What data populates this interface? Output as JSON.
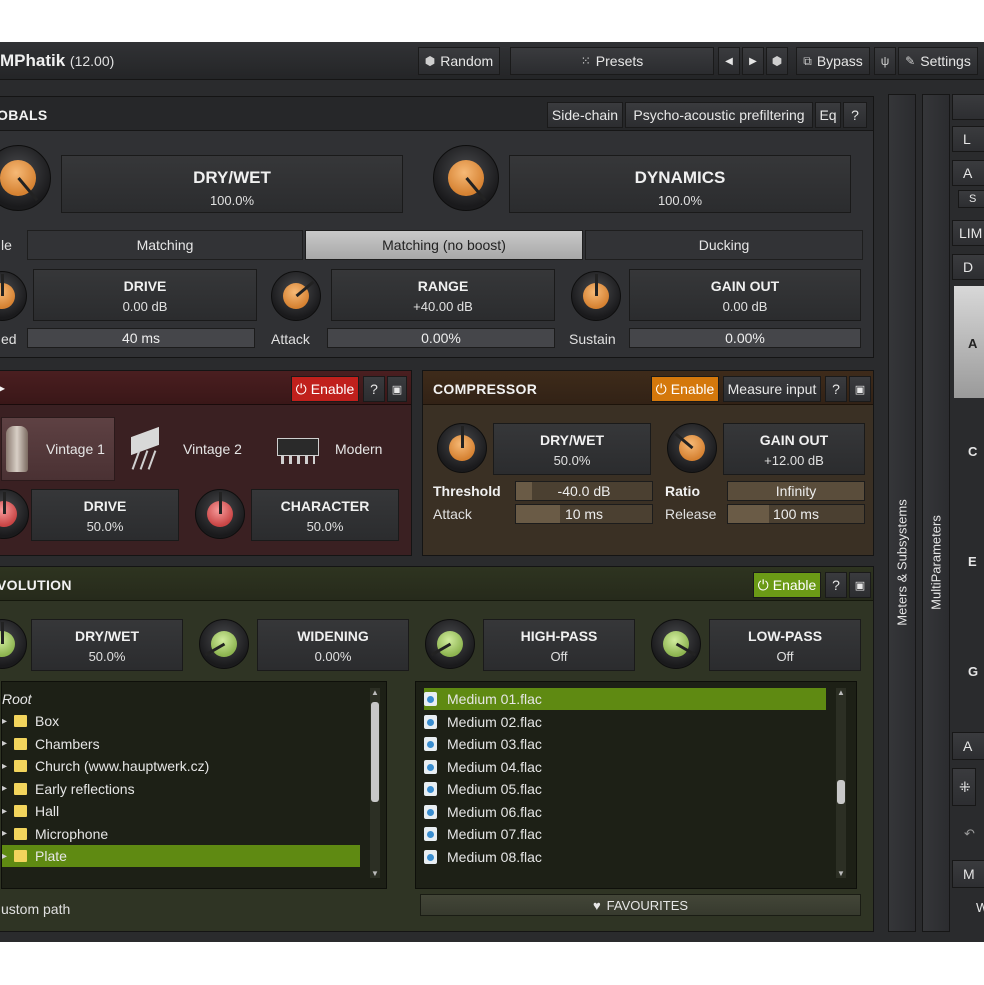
{
  "app": {
    "title": "MPhatik",
    "version": "(12.00)"
  },
  "toolbar": {
    "random": "Random",
    "presets": "Presets",
    "prev": "◀",
    "next": "▶",
    "bypass": "Bypass",
    "settings": "Settings"
  },
  "globals": {
    "title": "OBALS",
    "buttons": {
      "sidechain": "Side-chain",
      "psycho": "Psycho-acoustic prefiltering",
      "eq": "Eq",
      "help": "?"
    },
    "drywet": {
      "name": "DRY/WET",
      "value": "100.0%",
      "knob_level": 1.0
    },
    "dynamics": {
      "name": "DYNAMICS",
      "value": "100.0%",
      "knob_level": 1.0
    },
    "mode_prefix": "le",
    "modes": [
      {
        "label": "Matching",
        "active": false
      },
      {
        "label": "Matching (no boost)",
        "active": true
      },
      {
        "label": "Ducking",
        "active": false
      }
    ],
    "drive": {
      "name": "DRIVE",
      "value": "0.00 dB"
    },
    "range": {
      "name": "RANGE",
      "value": "+40.00 dB"
    },
    "gainout": {
      "name": "GAIN OUT",
      "value": "0.00 dB"
    },
    "speed": {
      "label": "ed",
      "value": "40 ms"
    },
    "attack": {
      "label": "Attack",
      "value": "0.00%"
    },
    "sustain": {
      "label": "Sustain",
      "value": "0.00%"
    }
  },
  "saturation": {
    "enable": "Enable",
    "help": "?",
    "modes": [
      {
        "label": "Vintage 1",
        "selected": true
      },
      {
        "label": "Vintage 2",
        "selected": false
      },
      {
        "label": "Modern",
        "selected": false
      }
    ],
    "drive": {
      "name": "DRIVE",
      "value": "50.0%"
    },
    "character": {
      "name": "CHARACTER",
      "value": "50.0%"
    }
  },
  "compressor": {
    "title": "COMPRESSOR",
    "enable": "Enable",
    "measure": "Measure input",
    "help": "?",
    "drywet": {
      "name": "DRY/WET",
      "value": "50.0%"
    },
    "gainout": {
      "name": "GAIN OUT",
      "value": "+12.00 dB"
    },
    "threshold": {
      "label": "Threshold",
      "value": "-40.0 dB",
      "level": 0.2
    },
    "ratio": {
      "label": "Ratio",
      "value": "Infinity",
      "level": 1.0
    },
    "attack": {
      "label": "Attack",
      "value": "10 ms",
      "level": 0.3
    },
    "release": {
      "label": "Release",
      "value": "100 ms",
      "level": 0.3
    }
  },
  "convolution": {
    "title": "VOLUTION",
    "enable": "Enable",
    "help": "?",
    "drywet": {
      "name": "DRY/WET",
      "value": "50.0%"
    },
    "widening": {
      "name": "WIDENING",
      "value": "0.00%"
    },
    "highpass": {
      "name": "HIGH-PASS",
      "value": "Off"
    },
    "lowpass": {
      "name": "LOW-PASS",
      "value": "Off"
    },
    "tree_root": "Root",
    "folders": [
      "Box",
      "Chambers",
      "Church (www.hauptwerk.cz)",
      "Early reflections",
      "Hall",
      "Microphone",
      "Plate"
    ],
    "selected_folder": "Plate",
    "files": [
      "Medium 01.flac",
      "Medium 02.flac",
      "Medium 03.flac",
      "Medium 04.flac",
      "Medium 05.flac",
      "Medium 06.flac",
      "Medium 07.flac",
      "Medium 08.flac"
    ],
    "selected_file": "Medium 01.flac",
    "custom_path": "ustom path",
    "favourites": "FAVOURITES"
  },
  "side": {
    "meters": "Meters & Subsystems",
    "multiparams": "MultiParameters",
    "right_buttons": [
      "L",
      "A",
      "S",
      "LIM",
      "D"
    ],
    "right_letters": [
      "A",
      "C",
      "E",
      "G"
    ],
    "bottom_buttons": [
      "A",
      "M"
    ],
    "bottom_letter": "W"
  },
  "colors": {
    "enable_red": "#c0201c",
    "enable_orange": "#d4780c",
    "enable_green": "#6b9a16",
    "selection_green": "#5f8a12"
  }
}
